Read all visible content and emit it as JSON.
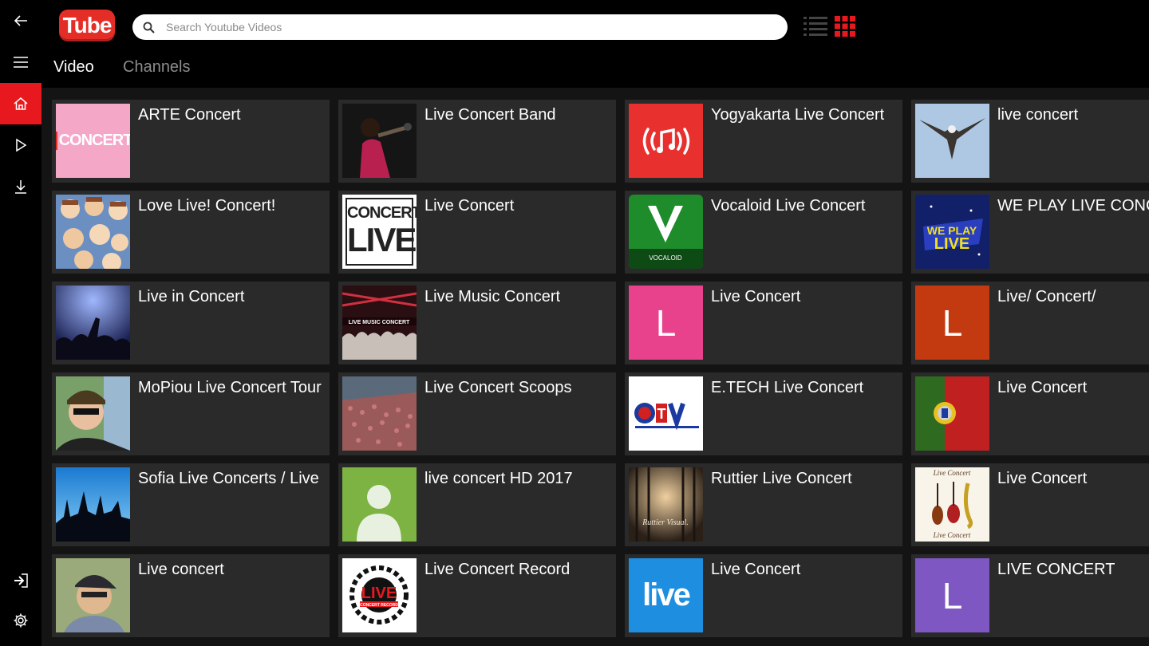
{
  "app": {
    "logo_text": "Tube",
    "search_placeholder": "Search Youtube Videos",
    "tabs": [
      "Video",
      "Channels"
    ],
    "accent_color": "#e8191e"
  },
  "rail": {
    "items": [
      "back-arrow-icon",
      "menu-icon",
      "home-icon",
      "play-icon",
      "download-icon",
      "sign-in-icon",
      "settings-icon"
    ]
  },
  "channels": [
    {
      "title": "ARTE Concert",
      "thumb": "ARTE Concert logo",
      "color": "#f5a7c8"
    },
    {
      "title": "Live Concert Band",
      "thumb": "singer photo",
      "color": "#1a1a1a"
    },
    {
      "title": "Yogyakarta Live Concert",
      "thumb": "music broadcast icon",
      "color": "#e8302f"
    },
    {
      "title": "live concert",
      "thumb": "eagle photo",
      "color": "#a9c4e0"
    },
    {
      "title": "Love Live! Concert!",
      "thumb": "anime collage",
      "color": "#5a7fb0"
    },
    {
      "title": "Live Concert",
      "thumb": "CONCERT LIVE text logo",
      "color": "#ffffff"
    },
    {
      "title": "Vocaloid Live Concert",
      "thumb": "VOCALOID logo",
      "color": "#1e8a2a"
    },
    {
      "title": "WE PLAY LIVE CONCERT",
      "thumb": "WE PLAY LIVE logo",
      "color": "#1a2a8a"
    },
    {
      "title": "Live in Concert",
      "thumb": "concert crowd photo",
      "color": "#2a3a7a"
    },
    {
      "title": "Live Music Concert",
      "thumb": "LIVE MUSIC CONCERT stage",
      "color": "#3a1a1a"
    },
    {
      "title": "Live Concert",
      "thumb": "letter",
      "letter": "L",
      "color": "#e8428c"
    },
    {
      "title": "Live/ Concert/",
      "thumb": "letter",
      "letter": "L",
      "color": "#c43a10"
    },
    {
      "title": "MoPiou Live Concert Tour",
      "thumb": "selfie photo",
      "color": "#6a8a5a"
    },
    {
      "title": "Live Concert Scoops",
      "thumb": "crowd photo",
      "color": "#8a4a4a"
    },
    {
      "title": "E.TECH Live Concert",
      "thumb": "TV logo",
      "color": "#ffffff"
    },
    {
      "title": "Live Concert",
      "thumb": "Portugal flag",
      "color": "#b82020"
    },
    {
      "title": "Sofia Live Concerts / Live",
      "thumb": "silhouette crowd",
      "color": "#3a9ae0"
    },
    {
      "title": "live concert HD 2017",
      "thumb": "default avatar",
      "color": "#7cb342"
    },
    {
      "title": "Ruttier Live Concert",
      "thumb": "Ruttier Visual forest",
      "color": "#5a4a3a"
    },
    {
      "title": "Live Concert",
      "thumb": "Live Concert instruments",
      "color": "#f6f2e8"
    },
    {
      "title": "Live concert",
      "thumb": "man with cap photo",
      "color": "#8a9a6a"
    },
    {
      "title": "Live Concert Record",
      "thumb": "LIVE CONCERT RECORD logo",
      "color": "#ffffff"
    },
    {
      "title": "Live Concert",
      "thumb": "live text logo",
      "color": "#1e8fe0"
    },
    {
      "title": "LIVE CONCERT",
      "thumb": "letter",
      "letter": "L",
      "color": "#7e57c2"
    }
  ]
}
